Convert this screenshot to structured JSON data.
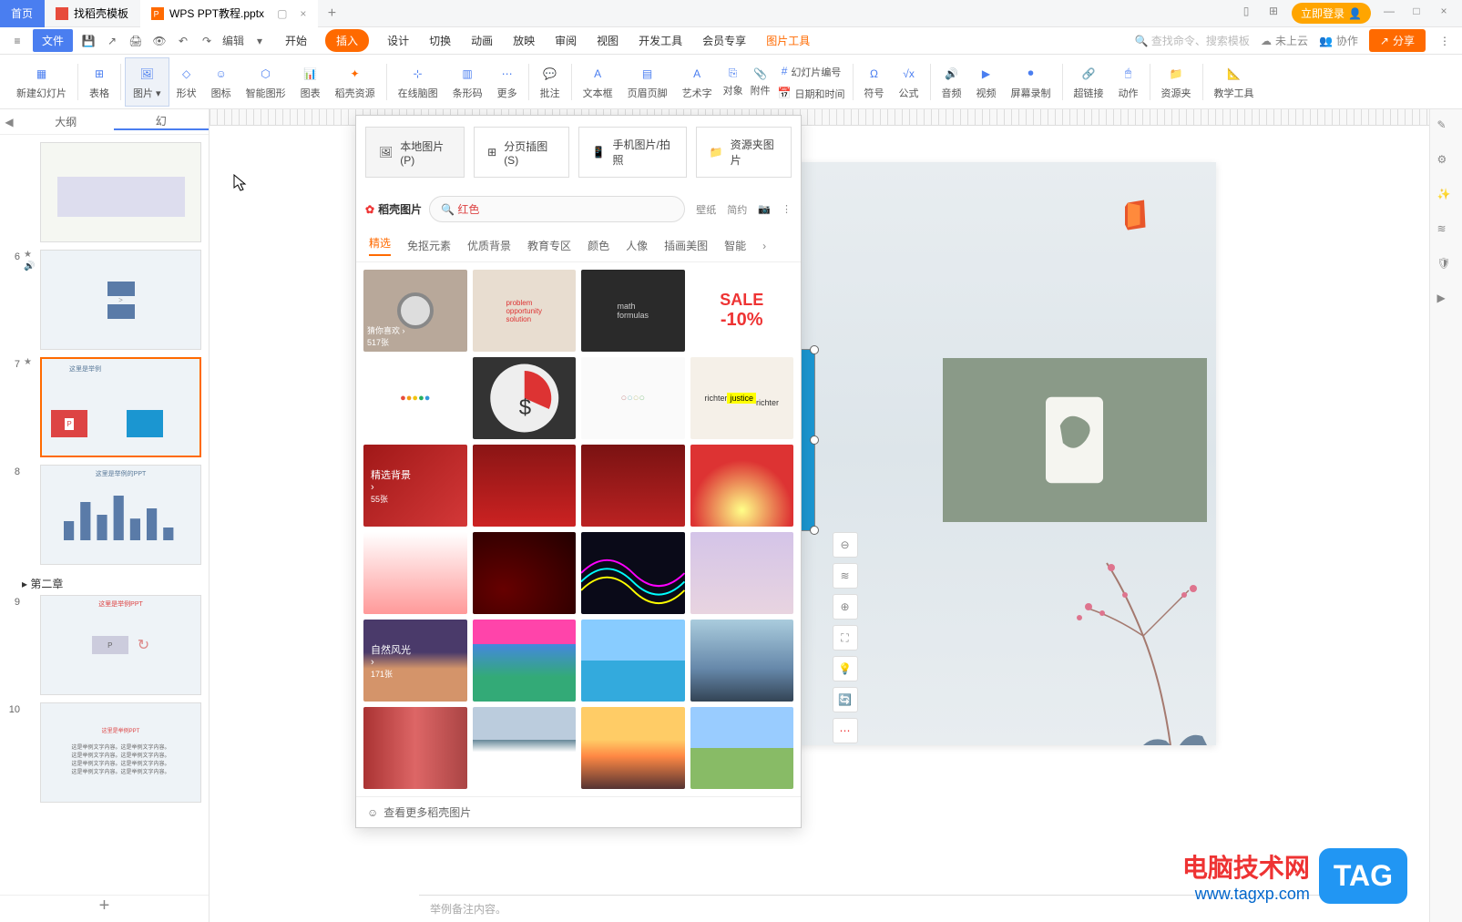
{
  "titlebar": {
    "home": "首页",
    "tab1": "找稻壳模板",
    "tab2": "WPS PPT教程.pptx",
    "login": "立即登录"
  },
  "menubar": {
    "file": "文件",
    "edit": "编辑",
    "tabs": [
      "开始",
      "插入",
      "设计",
      "切换",
      "动画",
      "放映",
      "审阅",
      "视图",
      "开发工具",
      "会员专享"
    ],
    "context": "图片工具",
    "search_placeholder": "查找命令、搜索模板",
    "cloud": "未上云",
    "collab": "协作",
    "share": "分享"
  },
  "ribbon": {
    "items": [
      {
        "label": "新建幻灯片"
      },
      {
        "label": "表格"
      },
      {
        "label": "图片"
      },
      {
        "label": "形状"
      },
      {
        "label": "图标"
      },
      {
        "label": "智能图形"
      },
      {
        "label": "图表"
      },
      {
        "label": "稻壳资源"
      },
      {
        "label": "在线脑图"
      },
      {
        "label": "条形码"
      },
      {
        "label": "更多"
      },
      {
        "label": "批注"
      },
      {
        "label": "文本框"
      },
      {
        "label": "页眉页脚"
      },
      {
        "label": "艺术字"
      },
      {
        "label": "对象"
      },
      {
        "label": "附件"
      },
      {
        "label": "幻灯片编号"
      },
      {
        "label": "日期和时间"
      },
      {
        "label": "符号"
      },
      {
        "label": "公式"
      },
      {
        "label": "音频"
      },
      {
        "label": "视频"
      },
      {
        "label": "屏幕录制"
      },
      {
        "label": "超链接"
      },
      {
        "label": "动作"
      },
      {
        "label": "资源夹"
      },
      {
        "label": "教学工具"
      }
    ]
  },
  "sidepanel": {
    "tab_outline": "大纲",
    "tab_slides": "幻",
    "section": "第二章",
    "thumbs": [
      {
        "num": "6"
      },
      {
        "num": "7"
      },
      {
        "num": "8"
      },
      {
        "num": "9"
      },
      {
        "num": "10"
      }
    ]
  },
  "dropdown": {
    "btn_local": "本地图片(P)",
    "btn_split": "分页插图(S)",
    "btn_phone": "手机图片/拍照",
    "btn_folder": "资源夹图片",
    "logo": "稻壳图片",
    "search_value": "红色",
    "filter1": "壁纸",
    "filter2": "简约",
    "cats": [
      "精选",
      "免抠元素",
      "优质背景",
      "教育专区",
      "颜色",
      "人像",
      "插画美图",
      "智能"
    ],
    "tile_sale": "SALE",
    "tile_sale2": "-10%",
    "tile_bg": "精选背景",
    "tile_bg_count": "55张",
    "tile_nature": "自然风光",
    "tile_nature_count": "171张",
    "tile_like": "猜你喜欢",
    "tile_like_count": "517张",
    "footer": "查看更多稻壳图片"
  },
  "slide": {
    "title": "这里是举例PPT"
  },
  "notes": {
    "placeholder": "举例备注内容。"
  },
  "watermark": {
    "title": "电脑技术网",
    "url": "www.tagxp.com",
    "tag": "TAG"
  }
}
